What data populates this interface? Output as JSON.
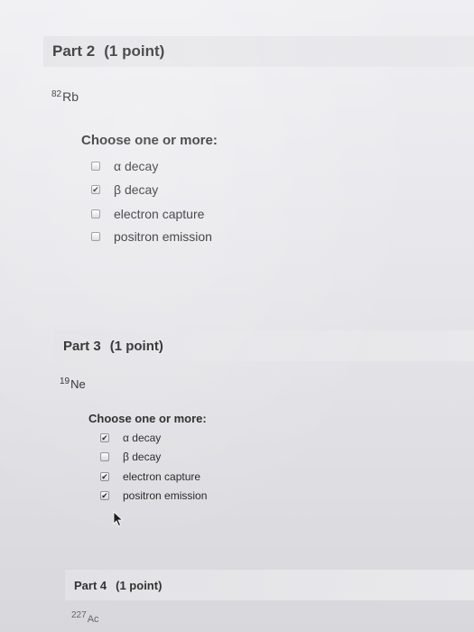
{
  "part2": {
    "title": "Part 2",
    "points": "(1 point)",
    "isotope_mass": "82",
    "isotope_symbol": "Rb",
    "prompt": "Choose one or more:",
    "options": [
      {
        "label": "α decay",
        "checked": false
      },
      {
        "label": "β decay",
        "checked": true
      },
      {
        "label": "electron capture",
        "checked": false
      },
      {
        "label": "positron emission",
        "checked": false
      }
    ]
  },
  "part3": {
    "title": "Part 3",
    "points": "(1 point)",
    "isotope_mass": "19",
    "isotope_symbol": "Ne",
    "prompt": "Choose one or more:",
    "options": [
      {
        "label": "α decay",
        "checked": true
      },
      {
        "label": "β decay",
        "checked": false
      },
      {
        "label": "electron capture",
        "checked": true
      },
      {
        "label": "positron emission",
        "checked": true
      }
    ]
  },
  "part4": {
    "title": "Part 4",
    "points": "(1 point)",
    "isotope_mass": "227",
    "isotope_symbol": "Ac"
  },
  "icons": {
    "checkmark": "✔",
    "cursor": "mouse-pointer-icon"
  },
  "colors": {
    "header_bg": "#e2e2e6",
    "page_bg": "#e9e9ec",
    "text": "#1f1f1f"
  }
}
